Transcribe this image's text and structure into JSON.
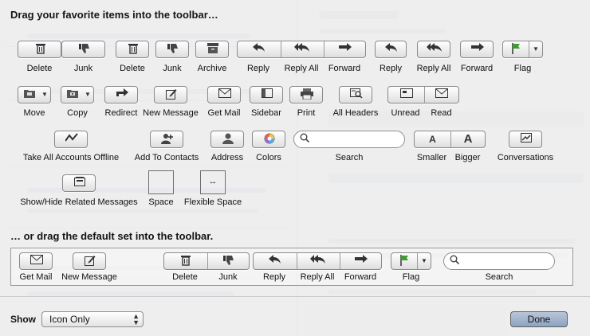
{
  "sheet": {
    "heading_top": "Drag your favorite items into the toolbar…",
    "heading_default": "… or drag the default set into the toolbar.",
    "show_label": "Show",
    "show_select_value": "Icon Only",
    "done_label": "Done"
  },
  "items": {
    "delete": "Delete",
    "junk": "Junk",
    "delete2": "Delete",
    "junk2": "Junk",
    "archive": "Archive",
    "reply": "Reply",
    "reply_all": "Reply All",
    "forward": "Forward",
    "reply2": "Reply",
    "reply_all2": "Reply All",
    "forward2": "Forward",
    "flag": "Flag",
    "move": "Move",
    "copy": "Copy",
    "redirect": "Redirect",
    "new_message": "New Message",
    "get_mail": "Get Mail",
    "sidebar": "Sidebar",
    "print": "Print",
    "all_headers": "All Headers",
    "unread": "Unread",
    "read": "Read",
    "take_offline": "Take All Accounts Offline",
    "add_contacts": "Add To Contacts",
    "address": "Address",
    "colors": "Colors",
    "search": "Search",
    "smaller": "Smaller",
    "bigger": "Bigger",
    "conversations": "Conversations",
    "show_hide_related": "Show/Hide Related Messages",
    "space": "Space",
    "flexible_space": "Flexible Space"
  },
  "default_set": {
    "get_mail": "Get Mail",
    "new_message": "New Message",
    "delete": "Delete",
    "junk": "Junk",
    "reply": "Reply",
    "reply_all": "Reply All",
    "forward": "Forward",
    "flag": "Flag",
    "search": "Search"
  },
  "colors": {
    "done_button": "#9fb2cc",
    "flag_green": "#3aa02c"
  }
}
